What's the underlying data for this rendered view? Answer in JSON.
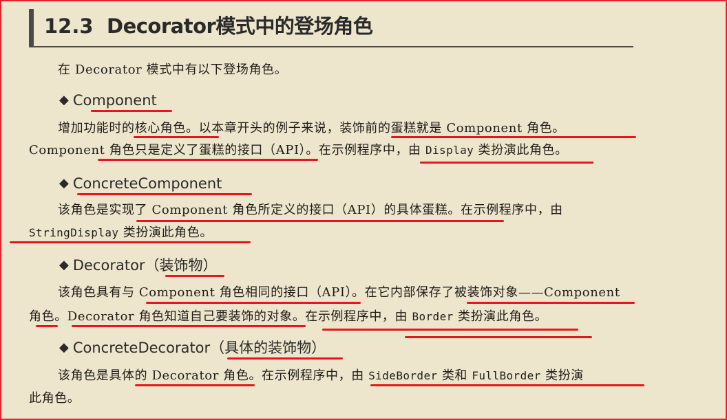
{
  "section": {
    "number": "12.3",
    "title": "Decorator模式中的登场角色"
  },
  "intro": "在 Decorator 模式中有以下登场角色。",
  "roles": [
    {
      "heading": "Component",
      "lines": [
        [
          {
            "t": "增加功能时的核心角色。以本章开头的例子来说，装饰前的蛋糕就是 Component 角色。"
          }
        ],
        [
          {
            "t": "Component 角色只是定义了蛋糕的接口（API）。在示例程序中，由 "
          },
          {
            "t": "Display",
            "mono": true
          },
          {
            "t": " 类扮演此角色。"
          }
        ]
      ]
    },
    {
      "heading": "ConcreteComponent",
      "lines": [
        [
          {
            "t": "该角色是实现了 Component 角色所定义的接口（API）的具体蛋糕。在示例程序中，由"
          }
        ],
        [
          {
            "t": "StringDisplay",
            "mono": true
          },
          {
            "t": " 类扮演此角色。"
          }
        ]
      ]
    },
    {
      "heading": "Decorator（装饰物）",
      "lines": [
        [
          {
            "t": "该角色具有与 Component 角色相同的接口（API）。在它内部保存了被装饰对象——Component"
          }
        ],
        [
          {
            "t": "角色。Decorator 角色知道自己要装饰的对象。在示例程序中，由 "
          },
          {
            "t": "Border",
            "mono": true
          },
          {
            "t": " 类扮演此角色。"
          }
        ]
      ]
    },
    {
      "heading": "ConcreteDecorator（具体的装饰物）",
      "lines": [
        [
          {
            "t": "该角色是具体的 Decorator 角色。在示例程序中，由 "
          },
          {
            "t": "SideBorder",
            "mono": true
          },
          {
            "t": " 类和 "
          },
          {
            "t": "FullBorder",
            "mono": true
          },
          {
            "t": " 类扮演"
          }
        ],
        [
          {
            "t": "此角色。"
          }
        ]
      ]
    }
  ],
  "colors": {
    "page_background": "#ede5cc",
    "frame_border": "#e52129",
    "underline_marker": "#e8141e",
    "heading_bar": "#4a4a4a"
  }
}
